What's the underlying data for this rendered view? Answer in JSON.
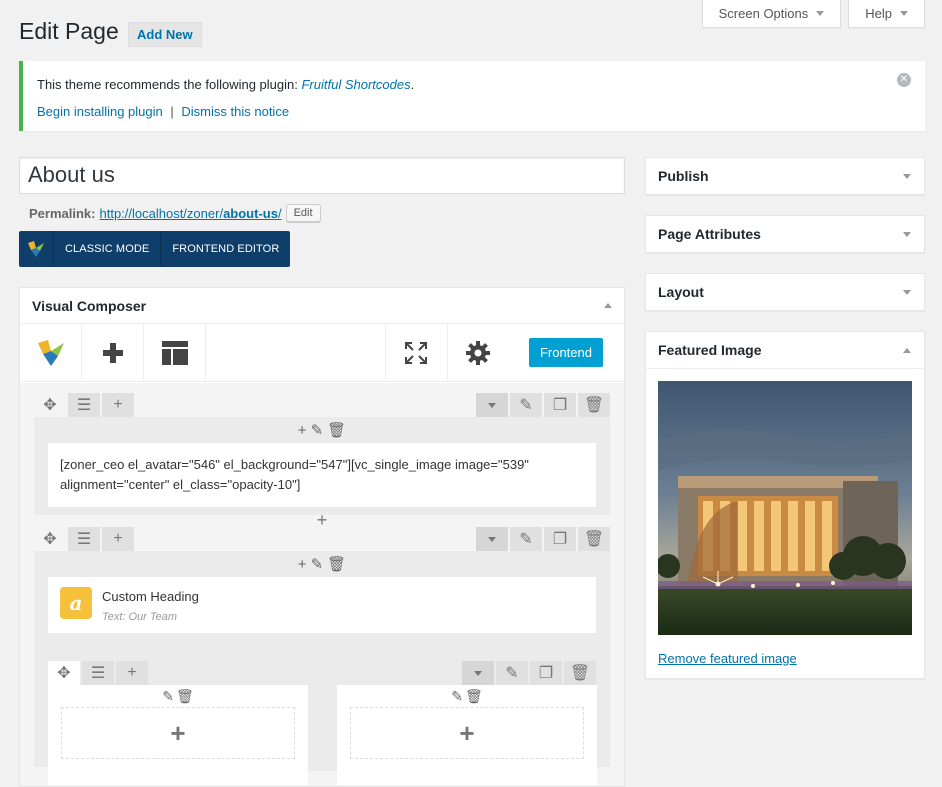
{
  "header": {
    "title": "Edit Page",
    "add_new": "Add New",
    "screen_options": "Screen Options",
    "help": "Help"
  },
  "notice": {
    "text_before": "This theme recommends the following plugin:",
    "plugin_name": "Fruitful Shortcodes",
    "text_after": ".",
    "begin_installing": "Begin installing plugin",
    "separator": "|",
    "dismiss": "Dismiss this notice"
  },
  "editor": {
    "title_value": "About us",
    "permalink_label": "Permalink:",
    "permalink_base": "http://localhost/zoner/",
    "permalink_slug": "about-us",
    "permalink_end": "/",
    "edit_button": "Edit"
  },
  "vc_bar": {
    "classic_mode": "CLASSIC MODE",
    "frontend_editor": "FRONTEND EDITOR"
  },
  "visual_composer": {
    "title": "Visual Composer",
    "frontend_button": "Frontend",
    "rows": [
      {
        "content": "[zoner_ceo el_avatar=\"546\" el_background=\"547\"][vc_single_image image=\"539\" alignment=\"center\" el_class=\"opacity-10\"]"
      },
      {
        "heading_icon_letter": "a",
        "heading_title": "Custom Heading",
        "heading_sub": "Text: Our Team"
      }
    ]
  },
  "sidebar": {
    "publish": "Publish",
    "page_attributes": "Page Attributes",
    "layout": "Layout",
    "featured_image": "Featured Image",
    "remove_featured": "Remove featured image"
  },
  "icons": {
    "move": "move-icon",
    "columns": "columns-icon",
    "plus": "plus-icon",
    "pencil": "pencil-icon",
    "trash": "trash-icon",
    "clone": "clone-icon",
    "chevron": "chevron-down-icon",
    "gear": "gear-icon",
    "fullscreen": "fullscreen-icon",
    "templates": "templates-icon",
    "vc_logo": "vc-logo-icon"
  },
  "colors": {
    "accent": "#0073aa",
    "notice_border": "#46b450",
    "vc_bar": "#0f3e6b",
    "frontend_button": "#00a0d2",
    "heading_icon": "#f5c03a"
  }
}
